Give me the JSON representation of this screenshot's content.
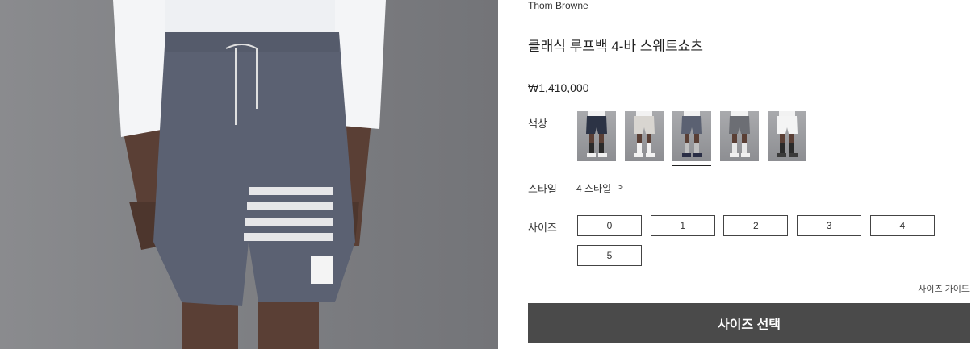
{
  "product": {
    "brand": "Thom Browne",
    "title": "클래식 루프백 4-바 스웨트쇼츠",
    "price": "₩1,410,000",
    "image_alt": "product-photo-grey-sweat-shorts"
  },
  "options": {
    "color_label": "색상",
    "style_label": "스타일",
    "style_value": "4 스타일",
    "style_arrow": ">",
    "size_label": "사이즈",
    "swatches": [
      {
        "name": "navy",
        "shorts_color": "#2c3345",
        "sock_color": "#2a2a2a",
        "shoe_color": "#f0f0f0"
      },
      {
        "name": "light-grey",
        "shorts_color": "#d8d5d0",
        "sock_color": "#f2f2f2",
        "shoe_color": "#f2f2f2"
      },
      {
        "name": "medium-grey",
        "shorts_color": "#5b6172",
        "sock_color": "#bfbfbf",
        "shoe_color": "#2a2e45",
        "selected": true
      },
      {
        "name": "grey-heather",
        "shorts_color": "#6c6e74",
        "sock_color": "#e8e8e8",
        "shoe_color": "#f0f0f0"
      },
      {
        "name": "white",
        "shorts_color": "#f4f4f4",
        "sock_color": "#2a2a2a",
        "shoe_color": "#3a3a3a"
      }
    ],
    "sizes": [
      "0",
      "1",
      "2",
      "3",
      "4",
      "5"
    ]
  },
  "links": {
    "size_guide": "사이즈 가이드"
  },
  "cta": {
    "label": "사이즈 선택"
  }
}
